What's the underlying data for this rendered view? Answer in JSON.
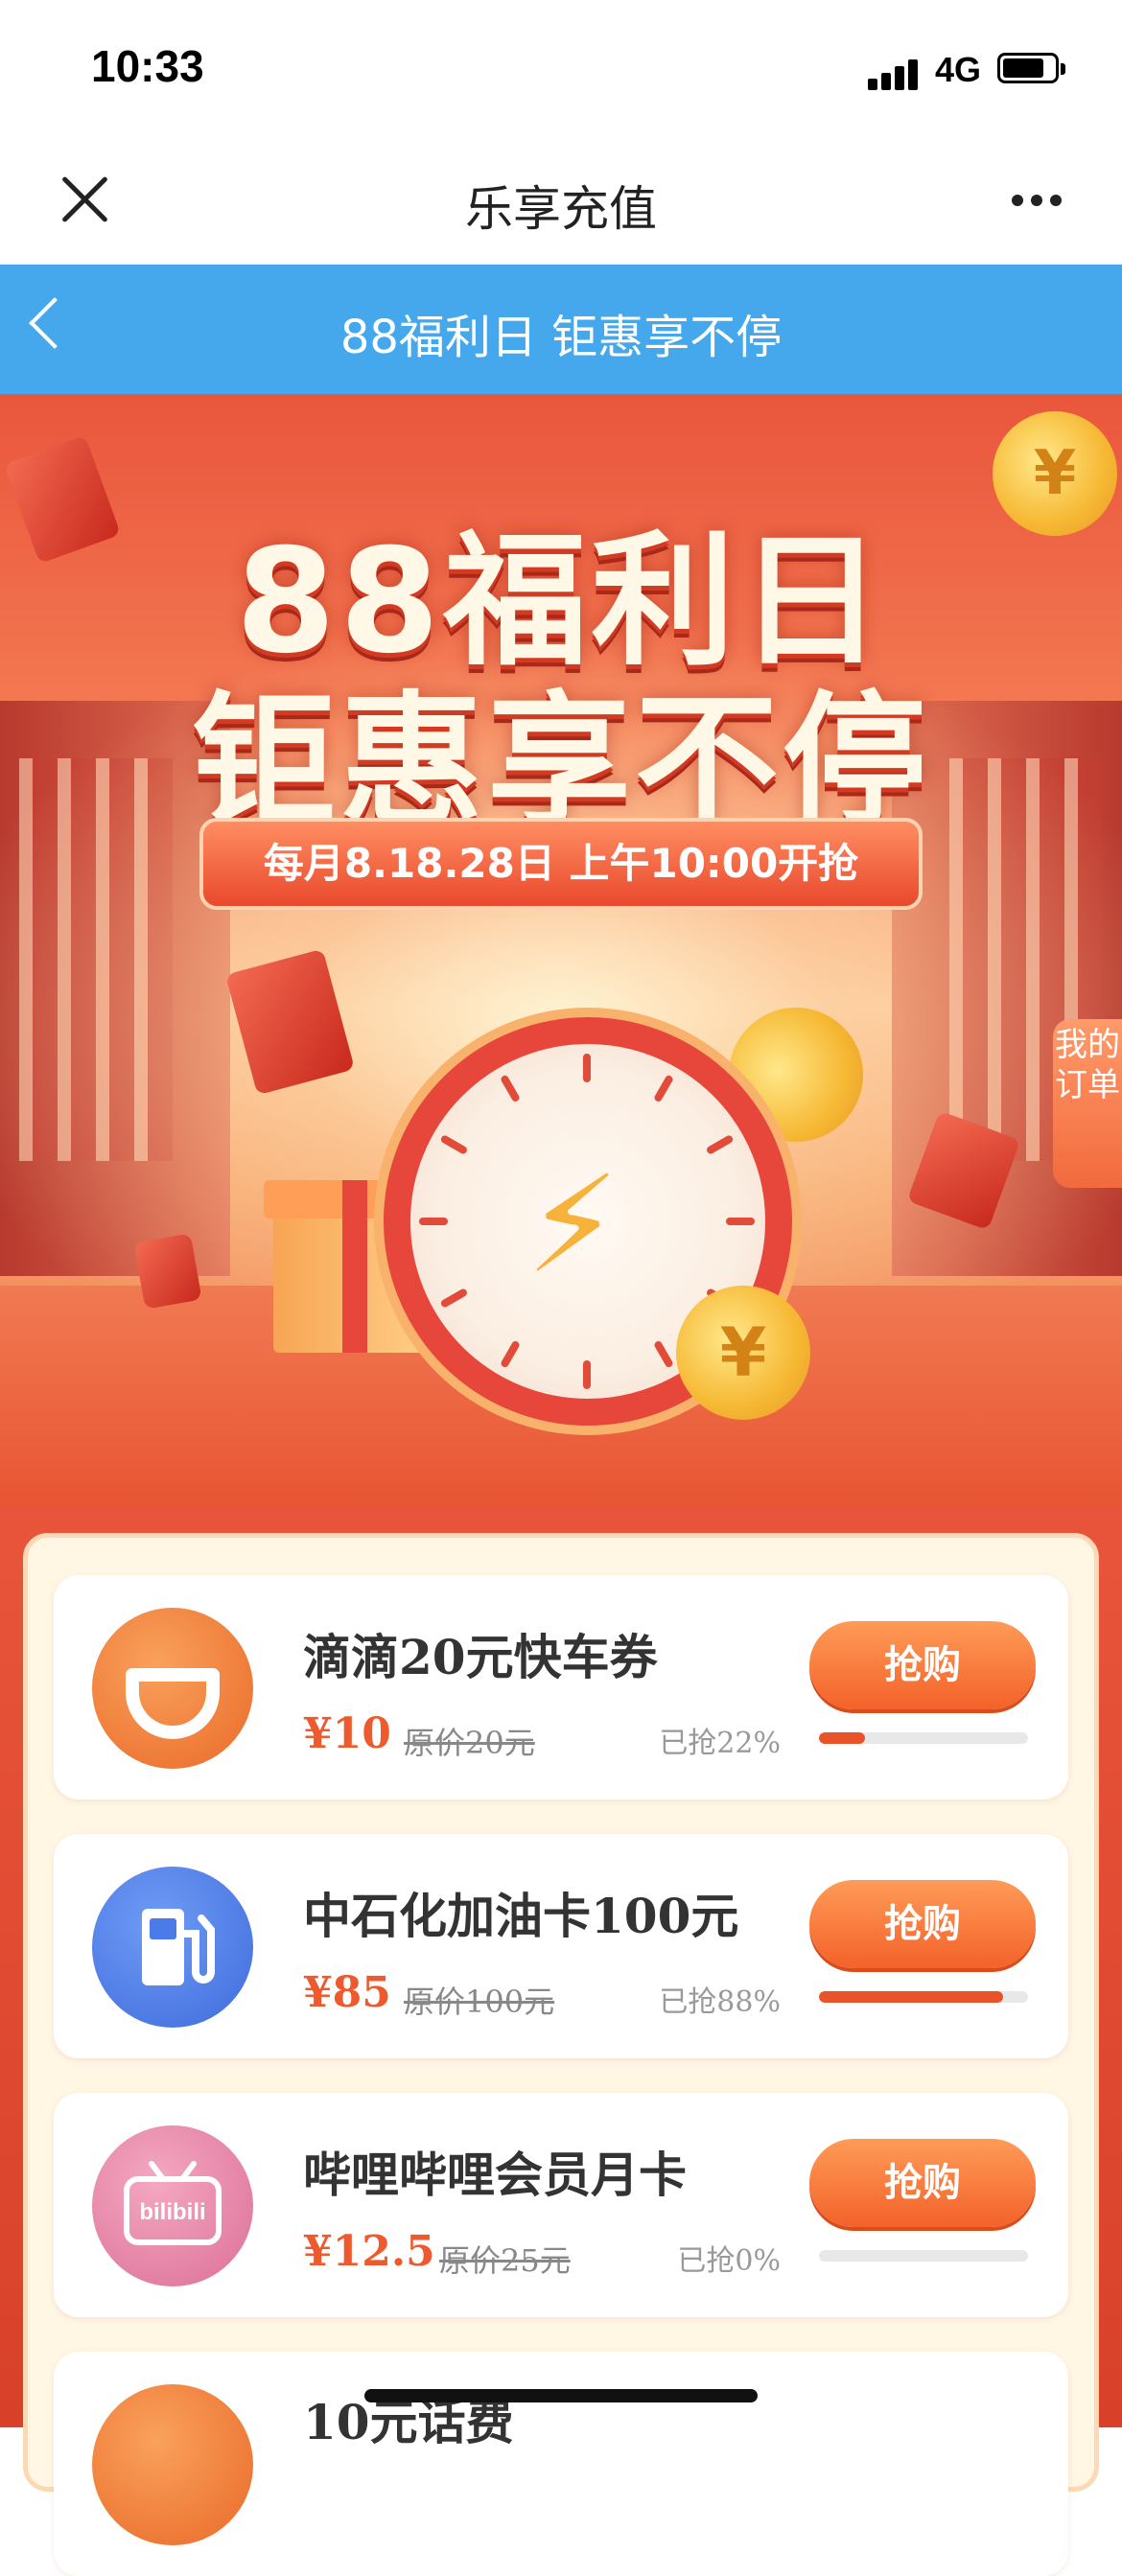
{
  "status_bar": {
    "time": "10:33",
    "network": "4G"
  },
  "nav": {
    "title": "乐享充值"
  },
  "banner_bar": {
    "title": "88福利日 钜惠享不停"
  },
  "hero": {
    "headline1": "88福利日",
    "headline2": "钜惠享不停",
    "schedule": "每月8.18.28日 上午10:00开抢",
    "side_tab": "我的订单",
    "coin_symbol": "¥"
  },
  "products": [
    {
      "name": "滴滴20元快车券",
      "price": "¥10",
      "original": "原价20元",
      "sold": "已抢22%",
      "progress": 0.22,
      "button": "抢购",
      "icon": "didi-logo-icon",
      "color": "#f0833f"
    },
    {
      "name": "中石化加油卡100元",
      "price": "¥85",
      "original": "原价100元",
      "sold": "已抢88%",
      "progress": 0.88,
      "button": "抢购",
      "icon": "fuel-pump-icon",
      "color": "#4a7be8"
    },
    {
      "name": "哔哩哔哩会员月卡",
      "price": "¥12.5",
      "original": "原价25元",
      "sold": "已抢0%",
      "progress": 0.0,
      "button": "抢购",
      "icon": "bilibili-logo-icon",
      "color": "#ea7fa4"
    },
    {
      "name": "10元话费",
      "icon": "phone-bill-icon",
      "color": "#f0833f"
    }
  ],
  "colors": {
    "accent": "#ed5a2e",
    "blue_bar": "#46a8ec",
    "button": "#f3622a"
  }
}
